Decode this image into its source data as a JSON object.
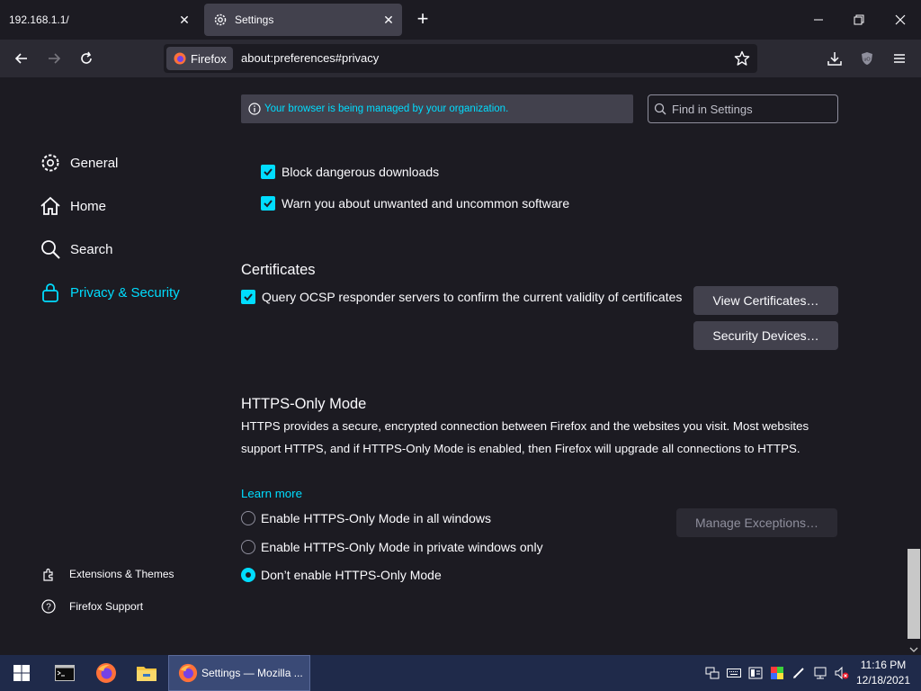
{
  "tabs": [
    {
      "title": "192.168.1.1/",
      "active": false
    },
    {
      "title": "Settings",
      "active": true
    }
  ],
  "window": {
    "new_tab": "+"
  },
  "navbar": {
    "identity_label": "Firefox",
    "url": "about:preferences#privacy"
  },
  "sidebar": {
    "items": [
      {
        "label": "General",
        "icon": "gear-icon"
      },
      {
        "label": "Home",
        "icon": "home-icon"
      },
      {
        "label": "Search",
        "icon": "search-icon"
      },
      {
        "label": "Privacy & Security",
        "icon": "lock-icon",
        "active": true
      }
    ],
    "footer": [
      {
        "label": "Extensions & Themes",
        "icon": "puzzle-icon"
      },
      {
        "label": "Firefox Support",
        "icon": "help-icon"
      }
    ]
  },
  "banner": {
    "managed_text": "Your browser is being managed by your organization."
  },
  "search": {
    "placeholder": "Find in Settings"
  },
  "security": {
    "block_downloads": "Block dangerous downloads",
    "warn_software": "Warn you about unwanted and uncommon software"
  },
  "certificates": {
    "title": "Certificates",
    "ocsp_label": "Query OCSP responder servers to confirm the current validity of certificates",
    "view_button": "View Certificates…",
    "devices_button": "Security Devices…"
  },
  "https_only": {
    "title": "HTTPS-Only Mode",
    "description": "HTTPS provides a secure, encrypted connection between Firefox and the websites you visit. Most websites support HTTPS, and if HTTPS-Only Mode is enabled, then Firefox will upgrade all connections to HTTPS.",
    "learn_more": "Learn more",
    "options": [
      {
        "label": "Enable HTTPS-Only Mode in all windows",
        "selected": false
      },
      {
        "label": "Enable HTTPS-Only Mode in private windows only",
        "selected": false
      },
      {
        "label": "Don’t enable HTTPS-Only Mode",
        "selected": true
      }
    ],
    "manage_button": "Manage Exceptions…"
  },
  "taskbar": {
    "task_title": "Settings — Mozilla ...",
    "time": "11:16 PM",
    "date": "12/18/2021"
  },
  "colors": {
    "accent": "#00ddff",
    "background": "#1c1b22",
    "toolbar": "#2b2a33",
    "taskbar": "#1f2a4a"
  }
}
